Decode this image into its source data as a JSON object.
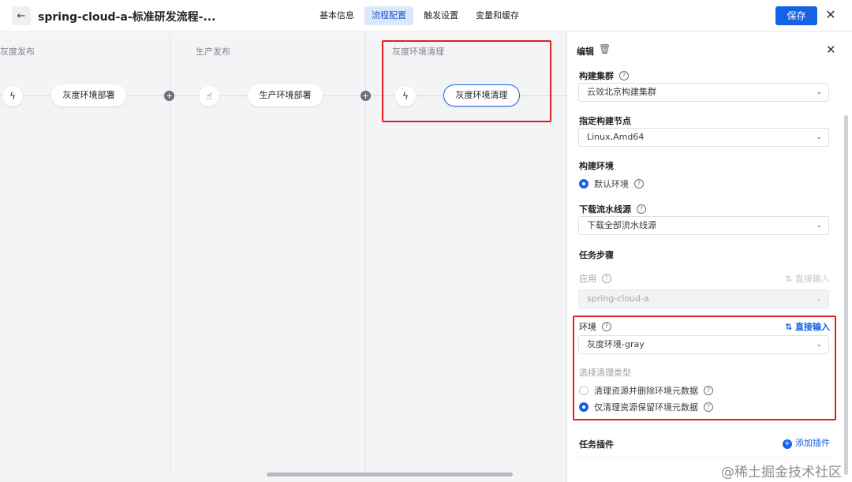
{
  "header": {
    "back_icon": "←",
    "title": "spring-cloud-a-标准研发流程-...",
    "tabs": [
      {
        "label": "基本信息",
        "active": false
      },
      {
        "label": "流程配置",
        "active": true
      },
      {
        "label": "触发设置",
        "active": false
      },
      {
        "label": "变量和缓存",
        "active": false
      }
    ],
    "save_label": "保存",
    "close_icon": "✕"
  },
  "canvas": {
    "stages": [
      {
        "title": "灰度发布",
        "trigger_icon": "ϟ",
        "job": "灰度环境部署"
      },
      {
        "title": "生产发布",
        "trigger_icon": "☝",
        "job": "生产环境部署"
      },
      {
        "title": "灰度环境清理",
        "trigger_icon": "ϟ",
        "job": "灰度环境清理"
      }
    ],
    "add_icon": "+"
  },
  "panel": {
    "title": "编辑",
    "trash_icon": "🗑",
    "close_icon": "✕",
    "build_cluster": {
      "label": "构建集群",
      "value": "云效北京构建集群"
    },
    "build_node": {
      "label": "指定构建节点",
      "value": "Linux,Amd64"
    },
    "build_env": {
      "label": "构建环境",
      "option": "默认环境"
    },
    "download_source": {
      "label": "下载流水线源",
      "value": "下载全部流水线源"
    },
    "task_steps": {
      "label": "任务步骤"
    },
    "app": {
      "label": "应用",
      "value": "spring-cloud-a",
      "direct_input": "直接输入"
    },
    "environment": {
      "label": "环境",
      "value": "灰度环境-gray",
      "direct_input": "直接输入"
    },
    "cleanup": {
      "label": "选择清理类型",
      "options": [
        {
          "label": "清理资源并删除环境元数据",
          "selected": false
        },
        {
          "label": "仅清理资源保留环境元数据",
          "selected": true
        }
      ]
    },
    "plugins": {
      "label": "任务插件",
      "add_label": "添加插件"
    }
  },
  "watermark": "@稀土掘金技术社区",
  "colors": {
    "accent": "#1463e5",
    "highlight": "#e02020"
  }
}
